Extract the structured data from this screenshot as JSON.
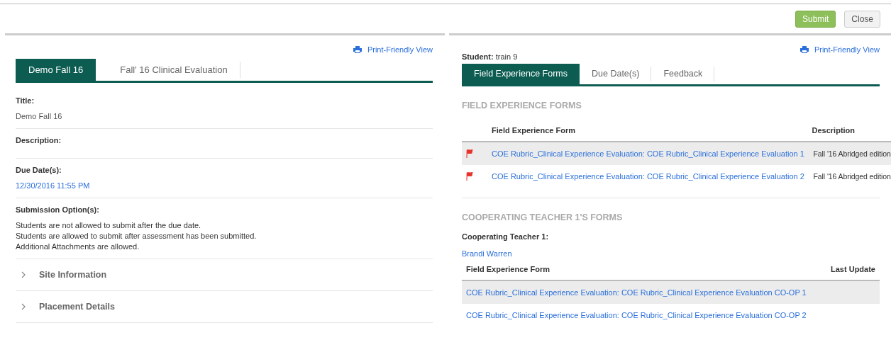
{
  "header": {
    "buttons": [
      {
        "label": "Submit",
        "kind": "primary"
      },
      {
        "label": "Close",
        "kind": "default"
      }
    ]
  },
  "left_panel": {
    "print_link": "Print-Friendly View",
    "tabs": [
      {
        "label": "Demo Fall 16",
        "selected": true
      },
      {
        "label": "Fall' 16 Clinical Evaluation",
        "selected": false
      }
    ],
    "fields": [
      {
        "label": "Title:",
        "kind": "text",
        "lines": [
          "Demo Fall 16"
        ]
      },
      {
        "label": "Description:"
      },
      {
        "label": "Due Date(s):",
        "kind": "link",
        "lines": [
          "12/30/2016 11:55 PM"
        ]
      },
      {
        "label": "Submission Option(s):",
        "kind": "plain",
        "lines": [
          "Students are not allowed to submit after the due date.",
          "Students are allowed to submit after assessment has been submitted.",
          "Additional Attachments are allowed."
        ]
      }
    ],
    "sections": [
      {
        "label": "Site Information",
        "expanded": false
      },
      {
        "label": "Placement Details",
        "expanded": false
      }
    ]
  },
  "right_panel": {
    "print_link": "Print-Friendly View",
    "student_label": "Student:",
    "student": "train 9",
    "tabs": [
      {
        "label": "Field Experience Forms",
        "selected": true
      },
      {
        "label": "Due Date(s)",
        "selected": false
      },
      {
        "label": "Feedback",
        "selected": false
      }
    ],
    "forms_heading": "FIELD EXPERIENCE FORMS",
    "forms_table": {
      "columns": [
        "Field Experience Form",
        "Description"
      ],
      "rows": [
        {
          "flagged": true,
          "form": "COE Rubric_Clinical Experience Evaluation: COE Rubric_Clinical Experience Evaluation 1",
          "description": "Fall '16 Abridged edition"
        },
        {
          "flagged": true,
          "form": "COE Rubric_Clinical Experience Evaluation: COE Rubric_Clinical Experience Evaluation 2",
          "description": "Fall '16 Abridged edition"
        }
      ]
    },
    "teacher_heading": "COOPERATING TEACHER 1'S FORMS",
    "teacher_label": "Cooperating Teacher 1:",
    "teacher": "Brandi Warren",
    "teacher_table": {
      "columns": [
        "Field Experience Form",
        "Last Update"
      ],
      "rows": [
        {
          "form": "COE Rubric_Clinical Experience Evaluation: COE Rubric_Clinical Experience Evaluation CO-OP 1"
        },
        {
          "form": "COE Rubric_Clinical Experience Evaluation: COE Rubric_Clinical Experience Evaluation CO-OP 2"
        }
      ]
    }
  }
}
